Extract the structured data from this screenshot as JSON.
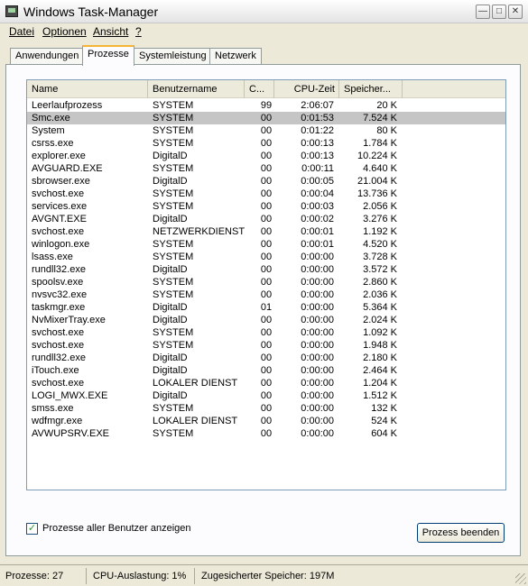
{
  "window": {
    "title": "Windows Task-Manager"
  },
  "menu": {
    "items": [
      "Datei",
      "Optionen",
      "Ansicht",
      "?"
    ]
  },
  "tabs": [
    "Anwendungen",
    "Prozesse",
    "Systemleistung",
    "Netzwerk"
  ],
  "active_tab": "Prozesse",
  "table": {
    "columns": [
      "Name",
      "Benutzername",
      "C...",
      "CPU-Zeit",
      "Speicher..."
    ],
    "rows": [
      [
        "Leerlaufprozess",
        "SYSTEM",
        "99",
        "2:06:07",
        "20 K"
      ],
      [
        "Smc.exe",
        "SYSTEM",
        "00",
        "0:01:53",
        "7.524 K"
      ],
      [
        "System",
        "SYSTEM",
        "00",
        "0:01:22",
        "80 K"
      ],
      [
        "csrss.exe",
        "SYSTEM",
        "00",
        "0:00:13",
        "1.784 K"
      ],
      [
        "explorer.exe",
        "DigitalD",
        "00",
        "0:00:13",
        "10.224 K"
      ],
      [
        "AVGUARD.EXE",
        "SYSTEM",
        "00",
        "0:00:11",
        "4.640 K"
      ],
      [
        "sbrowser.exe",
        "DigitalD",
        "00",
        "0:00:05",
        "21.004 K"
      ],
      [
        "svchost.exe",
        "SYSTEM",
        "00",
        "0:00:04",
        "13.736 K"
      ],
      [
        "services.exe",
        "SYSTEM",
        "00",
        "0:00:03",
        "2.056 K"
      ],
      [
        "AVGNT.EXE",
        "DigitalD",
        "00",
        "0:00:02",
        "3.276 K"
      ],
      [
        "svchost.exe",
        "NETZWERKDIENST",
        "00",
        "0:00:01",
        "1.192 K"
      ],
      [
        "winlogon.exe",
        "SYSTEM",
        "00",
        "0:00:01",
        "4.520 K"
      ],
      [
        "lsass.exe",
        "SYSTEM",
        "00",
        "0:00:00",
        "3.728 K"
      ],
      [
        "rundll32.exe",
        "DigitalD",
        "00",
        "0:00:00",
        "3.572 K"
      ],
      [
        "spoolsv.exe",
        "SYSTEM",
        "00",
        "0:00:00",
        "2.860 K"
      ],
      [
        "nvsvc32.exe",
        "SYSTEM",
        "00",
        "0:00:00",
        "2.036 K"
      ],
      [
        "taskmgr.exe",
        "DigitalD",
        "01",
        "0:00:00",
        "5.364 K"
      ],
      [
        "NvMixerTray.exe",
        "DigitalD",
        "00",
        "0:00:00",
        "2.024 K"
      ],
      [
        "svchost.exe",
        "SYSTEM",
        "00",
        "0:00:00",
        "1.092 K"
      ],
      [
        "svchost.exe",
        "SYSTEM",
        "00",
        "0:00:00",
        "1.948 K"
      ],
      [
        "rundll32.exe",
        "DigitalD",
        "00",
        "0:00:00",
        "2.180 K"
      ],
      [
        "iTouch.exe",
        "DigitalD",
        "00",
        "0:00:00",
        "2.464 K"
      ],
      [
        "svchost.exe",
        "LOKALER DIENST",
        "00",
        "0:00:00",
        "1.204 K"
      ],
      [
        "LOGI_MWX.EXE",
        "DigitalD",
        "00",
        "0:00:00",
        "1.512 K"
      ],
      [
        "smss.exe",
        "SYSTEM",
        "00",
        "0:00:00",
        "132 K"
      ],
      [
        "wdfmgr.exe",
        "LOKALER DIENST",
        "00",
        "0:00:00",
        "524 K"
      ],
      [
        "AVWUPSRV.EXE",
        "SYSTEM",
        "00",
        "0:00:00",
        "604 K"
      ]
    ],
    "selected_index": 1
  },
  "footer": {
    "checkbox_label": "Prozesse aller Benutzer anzeigen",
    "checkbox_checked": true,
    "end_process_label": "Prozess beenden"
  },
  "statusbar": {
    "processes": "Prozesse: 27",
    "cpu": "CPU-Auslastung: 1%",
    "memory": "Zugesicherter Speicher: 197M"
  },
  "colors": {
    "tab_highlight": "#f5b433",
    "selected_row": "#c5c5c5",
    "checkbox_check": "#21a121"
  }
}
